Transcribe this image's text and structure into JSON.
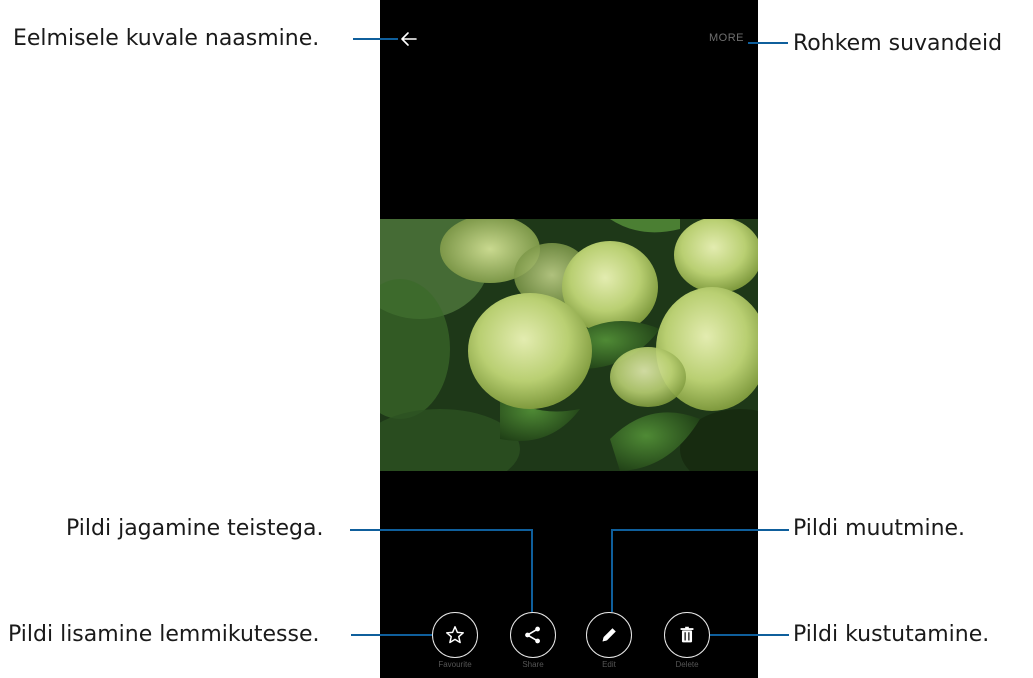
{
  "viewer": {
    "more_label": "MORE",
    "toolbar": [
      {
        "id": "favourite",
        "label": "Favourite",
        "icon": "star-icon"
      },
      {
        "id": "share",
        "label": "Share",
        "icon": "share-icon"
      },
      {
        "id": "edit",
        "label": "Edit",
        "icon": "pencil-icon"
      },
      {
        "id": "delete",
        "label": "Delete",
        "icon": "trash-icon"
      }
    ]
  },
  "callouts": {
    "back": "Eelmisele kuvale naasmine.",
    "more": "Rohkem suvandeid",
    "share": "Pildi jagamine teistega.",
    "edit": "Pildi muutmine.",
    "favourite": "Pildi lisamine lemmikutesse.",
    "delete": "Pildi kustutamine."
  },
  "colors": {
    "callout_line": "#0f5f9c",
    "screen_background": "#000000"
  }
}
